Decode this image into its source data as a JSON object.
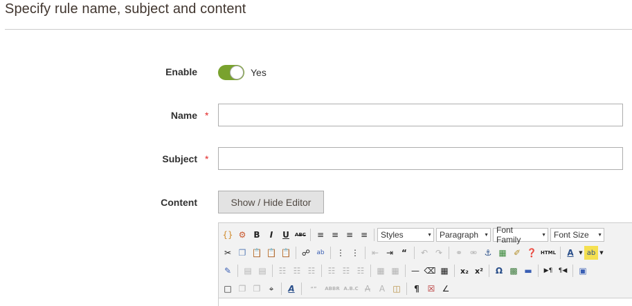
{
  "section": {
    "title": "Specify rule name, subject and content"
  },
  "form": {
    "enable": {
      "label": "Enable",
      "value_text": "Yes",
      "on": true
    },
    "name": {
      "label": "Name",
      "required_mark": "*",
      "value": ""
    },
    "subject": {
      "label": "Subject",
      "required_mark": "*",
      "value": ""
    },
    "content": {
      "label": "Content",
      "toggle_editor_label": "Show / Hide Editor"
    }
  },
  "editor": {
    "selects": {
      "styles": "Styles",
      "format": "Paragraph",
      "font_family": "Font Family",
      "font_size": "Font Size"
    }
  },
  "colors": {
    "accent_toggle": "#79a22e",
    "required": "#e22626",
    "button_bg": "#e3e3e3"
  }
}
